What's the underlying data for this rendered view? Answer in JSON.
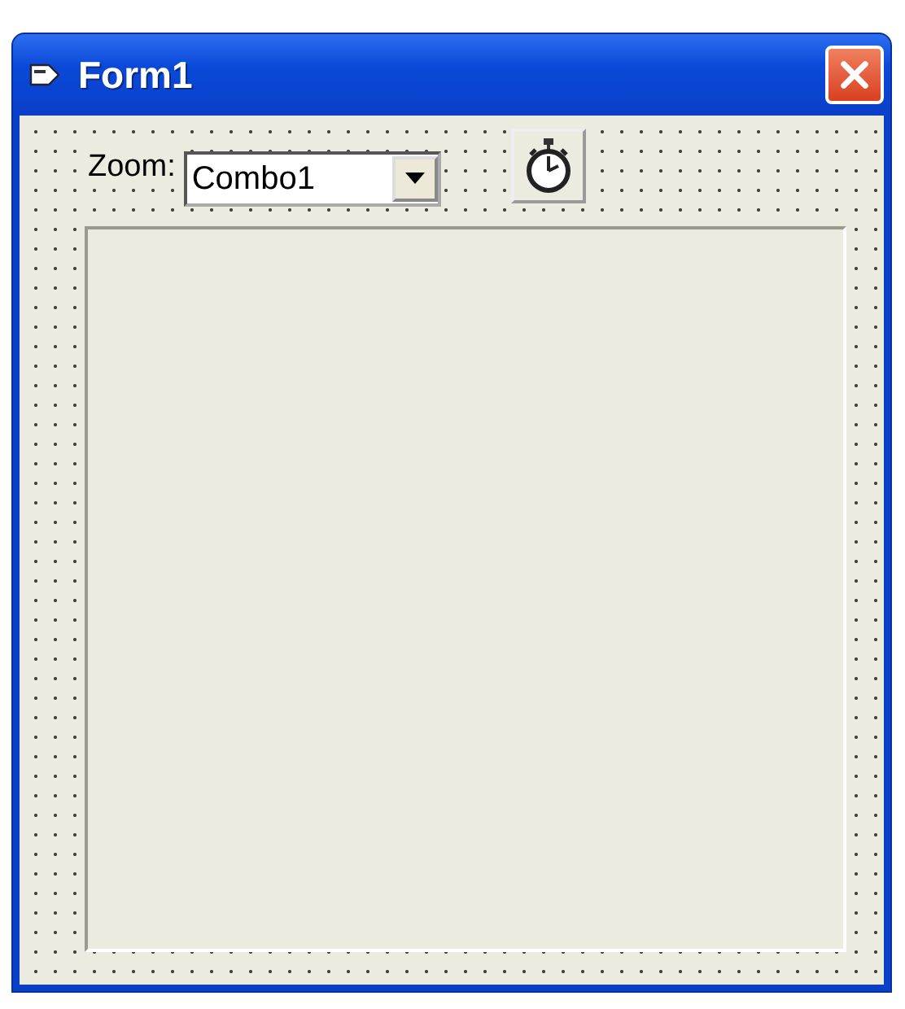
{
  "window": {
    "title": "Form1"
  },
  "form": {
    "label": "Zoom:",
    "combo": {
      "value": "Combo1"
    },
    "timer": {
      "kind": "timer"
    },
    "picture_box": {
      "kind": "box"
    }
  }
}
